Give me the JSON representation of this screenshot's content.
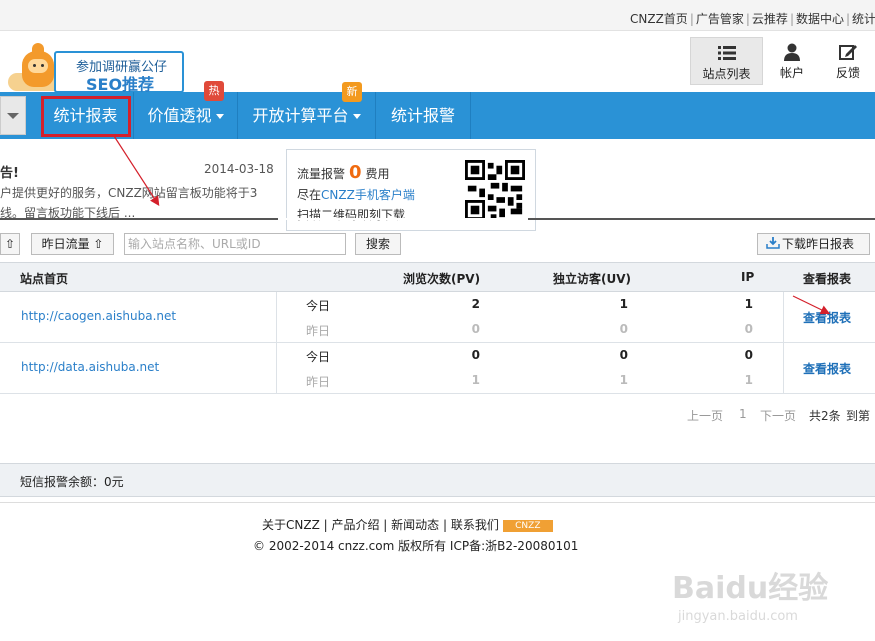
{
  "toplinks": {
    "items": [
      "CNZZ首页",
      "广告管家",
      "云推荐",
      "数据中心",
      "统计"
    ],
    "separator": "|"
  },
  "logo": {
    "line1": "参加调研赢公仔",
    "line2": "SEO推荐"
  },
  "header_buttons": {
    "sites": {
      "label": "站点列表",
      "icon": "list-icon"
    },
    "account": {
      "label": "帐户",
      "icon": "user-icon"
    },
    "feedback": {
      "label": "反馈",
      "icon": "edit-icon"
    }
  },
  "nav": {
    "items": [
      {
        "label": "统计报表",
        "active": true
      },
      {
        "label": "价值透视",
        "badge": "热",
        "badge_color": "#e04a3a",
        "dropdown": true
      },
      {
        "label": "开放计算平台",
        "badge": "新",
        "badge_color": "#f39a1f",
        "dropdown": true
      },
      {
        "label": "统计报警"
      }
    ],
    "bg_color": "#2a92d6"
  },
  "notice": {
    "title": "告!",
    "date": "2014-03-18",
    "line1": "户提供更好的服务，CNZZ网站留言板功能将于3",
    "line2": "线。留言板功能下线后 ..."
  },
  "alert_card": {
    "label": "流量报警",
    "count": "0",
    "suffix": "费用",
    "line2_prefix": "尽在",
    "line2_link": "CNZZ手机客户端",
    "line3": "扫描二维码即刻下载"
  },
  "filters": {
    "sort_first": "⇧",
    "yesterday_flow": "昨日流量 ⇧",
    "search_placeholder": "输入站点名称、URL或ID",
    "search_button": "搜索",
    "download_button": "下载昨日报表"
  },
  "table": {
    "headers": [
      "站点首页",
      "浏览次数(PV)",
      "独立访客(UV)",
      "IP",
      "查看报表"
    ],
    "rows": [
      {
        "url": "http://caogen.aishuba.net",
        "today_label": "今日",
        "yesterday_label": "昨日",
        "pv": [
          "2",
          "0"
        ],
        "uv": [
          "1",
          "0"
        ],
        "ip": [
          "1",
          "0"
        ],
        "action": "查看报表"
      },
      {
        "url": "http://data.aishuba.net",
        "today_label": "今日",
        "yesterday_label": "昨日",
        "pv": [
          "0",
          "1"
        ],
        "uv": [
          "0",
          "1"
        ],
        "ip": [
          "0",
          "1"
        ],
        "action": "查看报表"
      }
    ]
  },
  "pager": {
    "prev": "上一页",
    "page": "1",
    "next": "下一页",
    "total": "共2条",
    "goto": "到第"
  },
  "sms": {
    "text": "短信报警余额：0元"
  },
  "footer": {
    "links": "关于CNZZ | 产品介绍 | 新闻动态 | 联系我们",
    "badge": "CNZZ",
    "copyright": "© 2002-2014 cnzz.com 版权所有 ICP备:浙B2-20080101"
  },
  "watermark": {
    "brand": "Baidu经验",
    "url": "jingyan.baidu.com"
  }
}
